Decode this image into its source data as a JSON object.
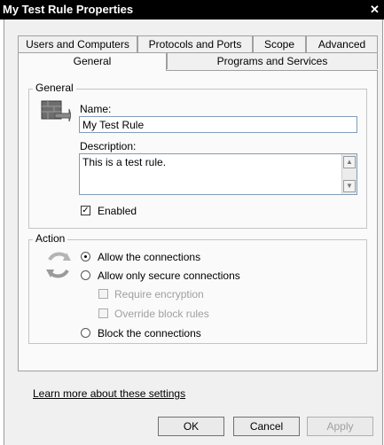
{
  "window": {
    "title": "My Test Rule Properties",
    "close_glyph": "✕"
  },
  "tabs": {
    "row1": [
      "Users and Computers",
      "Protocols and Ports",
      "Scope",
      "Advanced"
    ],
    "row2": [
      "General",
      "Programs and Services"
    ],
    "active": "General"
  },
  "general_group": {
    "legend": "General",
    "name_label": "Name:",
    "name_value": "My Test Rule",
    "description_label": "Description:",
    "description_value": "This is a test rule.",
    "enabled_label": "Enabled",
    "enabled_checked": true
  },
  "action_group": {
    "legend": "Action",
    "options": {
      "allow": "Allow the connections",
      "allow_secure": "Allow only secure connections",
      "require_encryption": "Require encryption",
      "override_block": "Override block rules",
      "block": "Block the connections"
    },
    "selected": "allow"
  },
  "footer": {
    "learn_more_link": "Learn more about these settings",
    "ok_label": "OK",
    "cancel_label": "Cancel",
    "apply_label": "Apply"
  }
}
